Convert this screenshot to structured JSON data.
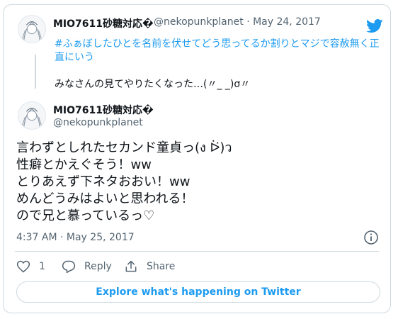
{
  "quoted": {
    "name": "MIO7611砂糖対応�",
    "handle": "@nekopunkplanet",
    "separator": "·",
    "date": "May 24, 2017",
    "hashtag": "#ふぁぼしたひとを名前を伏せてどう思ってるか割りとマジで容赦無く正直にいう",
    "text": "みなさんの見てやりたくなった…(〃_ _)σ〃"
  },
  "tweet": {
    "name": "MIO7611砂糖対応�",
    "handle": "@nekopunkplanet",
    "text": "言わずとしれたセカンド童貞っ(ง ᐖ)ว\n性癖とかえぐそう！ww\nとりあえず下ネタおおい！ww\nめんどうみはよいと思われる！\nので兄と慕っているっ♡",
    "time": "4:37 AM · May 25, 2017"
  },
  "actions": {
    "like_count": "1",
    "reply_label": "Reply",
    "share_label": "Share"
  },
  "explore_label": "Explore what's happening on Twitter",
  "icons": {
    "brand": "twitter-bird-icon",
    "info": "info-icon",
    "like": "heart-icon",
    "reply": "reply-icon",
    "share": "share-icon"
  },
  "colors": {
    "accent": "#1d9bf0",
    "text": "#0f1419",
    "secondary": "#536471",
    "border": "#cfd9de"
  }
}
